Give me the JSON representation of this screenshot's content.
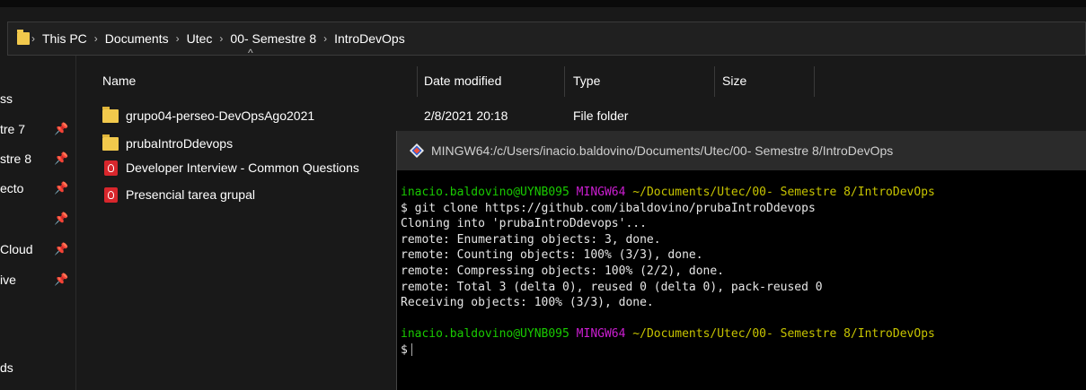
{
  "address_bar": {
    "segments": [
      "This PC",
      "Documents",
      "Utec",
      "00- Semestre 8",
      "IntroDevOps"
    ]
  },
  "nav": {
    "items": [
      {
        "label": "ss",
        "pinned": false
      },
      {
        "label": "tre 7",
        "pinned": true
      },
      {
        "label": "stre 8",
        "pinned": true
      },
      {
        "label": "ecto",
        "pinned": true
      },
      {
        "label": "",
        "pinned": true
      },
      {
        "label": "Cloud",
        "pinned": true
      },
      {
        "label": "ive",
        "pinned": true
      },
      {
        "label": "ds",
        "pinned": false
      }
    ]
  },
  "columns": {
    "name": "Name",
    "date_modified": "Date modified",
    "type": "Type",
    "size": "Size"
  },
  "files": [
    {
      "icon": "folder-icon",
      "name": "grupo04-perseo-DevOpsAgo2021",
      "date": "2/8/2021 20:18",
      "type": "File folder"
    },
    {
      "icon": "folder-icon",
      "name": "prubaIntroDdevops",
      "date": "",
      "type": ""
    },
    {
      "icon": "pdf-icon",
      "name": "Developer Interview - Common Questions",
      "date": "",
      "type": ""
    },
    {
      "icon": "pdf-icon",
      "name": "Presencial tarea grupal",
      "date": "",
      "type": ""
    }
  ],
  "terminal": {
    "title": "MINGW64:/c/Users/inacio.baldovino/Documents/Utec/00- Semestre 8/IntroDevOps",
    "prompt_user": "inacio.baldovino@UYNB095",
    "prompt_env": "MINGW64",
    "prompt_path": "~/Documents/Utec/00- Semestre 8/IntroDevOps",
    "command": "$ git clone https://github.com/ibaldovino/prubaIntroDdevops",
    "output": [
      "Cloning into 'prubaIntroDdevops'...",
      "remote: Enumerating objects: 3, done.",
      "remote: Counting objects: 100% (3/3), done.",
      "remote: Compressing objects: 100% (2/2), done.",
      "remote: Total 3 (delta 0), reused 0 (delta 0), pack-reused 0",
      "Receiving objects: 100% (3/3), done."
    ],
    "last_prompt": "$"
  },
  "colors": {
    "prompt_user": "#19cb00",
    "prompt_env": "#cb1ed1",
    "prompt_path": "#c7c400",
    "folder": "#f2c94c",
    "pdf": "#d8262c"
  }
}
